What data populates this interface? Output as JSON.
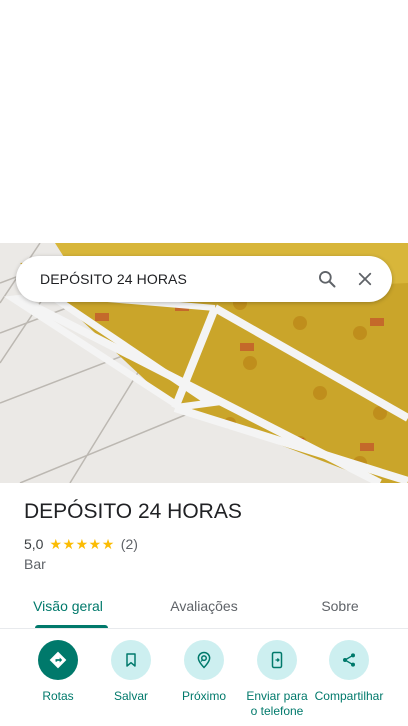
{
  "search": {
    "query": "DEPÓSITO 24 HORAS"
  },
  "place": {
    "name": "DEPÓSITO 24 HORAS",
    "rating": "5,0",
    "stars": 5,
    "reviews": "(2)",
    "category": "Bar"
  },
  "tabs": [
    {
      "label": "Visão geral"
    },
    {
      "label": "Avaliações"
    },
    {
      "label": "Sobre"
    }
  ],
  "actions": [
    {
      "label": "Rotas",
      "icon": "directions-icon"
    },
    {
      "label": "Salvar",
      "icon": "bookmark-icon"
    },
    {
      "label": "Próximo",
      "icon": "nearby-icon"
    },
    {
      "label": "Enviar para o telefone",
      "icon": "send-to-phone-icon"
    },
    {
      "label": "Compartilhar",
      "icon": "share-icon"
    }
  ],
  "colors": {
    "accent": "#00796b",
    "action_bg": "#cdeff0",
    "star": "#fbbc04"
  }
}
